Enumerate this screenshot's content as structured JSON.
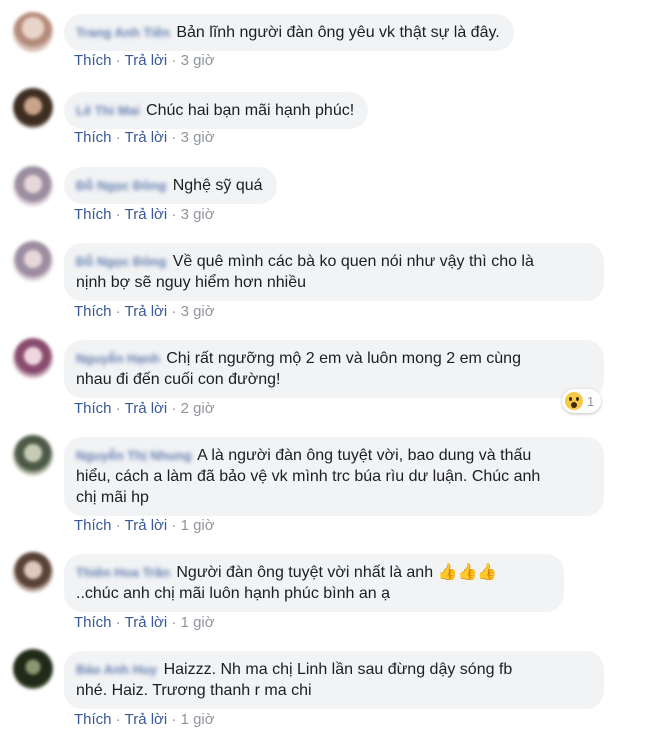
{
  "comments": [
    {
      "author": "Trang Anh Tiến",
      "text": "Bản lĩnh người đàn ông yêu vk thật sự là đây.",
      "like": "Thích",
      "reply": "Trả lời",
      "time": "3 giờ",
      "avatar_color": "#c9a8a0"
    },
    {
      "author": "Lê Thi Mai",
      "text": "Chúc hai bạn mãi hạnh phúc!",
      "like": "Thích",
      "reply": "Trả lời",
      "time": "3 giờ",
      "avatar_color": "#5a4a3a"
    },
    {
      "author": "Đỗ Ngọc Đông",
      "text": "Nghệ sỹ quá",
      "like": "Thích",
      "reply": "Trả lời",
      "time": "3 giờ",
      "avatar_color": "#b7a8b5"
    },
    {
      "author": "Đỗ Ngọc Đông",
      "text": "Về quê mình các bà ko quen nói như vậy thì cho là",
      "text2": "nịnh bợ sẽ nguy hiểm hơn nhiều",
      "like": "Thích",
      "reply": "Trả lời",
      "time": "3 giờ",
      "avatar_color": "#b7a8b5"
    },
    {
      "author": "Nguyễn Hạnh",
      "text": "Chị rất ngưỡng mộ 2 em và luôn mong 2 em cùng",
      "text2": "nhau đi đến cuối con đường!",
      "like": "Thích",
      "reply": "Trả lời",
      "time": "2 giờ",
      "avatar_color": "#8a5a78",
      "reaction_count": "1"
    },
    {
      "author": "Nguyễn Thị Nhung",
      "text": "A là người đàn ông tuyệt vời, bao dung và thấu",
      "text2": "hiểu, cách a làm đã bảo vệ vk mình trc búa rìu dư luận. Chúc anh",
      "text3": "chị mãi hp",
      "like": "Thích",
      "reply": "Trả lời",
      "time": "1 giờ",
      "avatar_color": "#6f7a62"
    },
    {
      "author": "Thiên Hoa Trần",
      "text": "Người đàn ông tuyệt vời nhất là anh",
      "emoji": "👍👍👍",
      "text2": "..chúc anh chị mãi luôn hạnh phúc bình an ạ",
      "like": "Thích",
      "reply": "Trả lời",
      "time": "1 giờ",
      "avatar_color": "#7a6458"
    },
    {
      "author": "Bảo Anh Huy",
      "text": "Haizzz. Nh ma chị Linh lần sau đừng dậy sóng fb",
      "text2": "nhé. Haiz. Trương thanh r ma chi",
      "like": "Thích",
      "reply": "Trả lời",
      "time": "1 giờ",
      "avatar_color": "#2f3a2a"
    }
  ],
  "separator": "·"
}
